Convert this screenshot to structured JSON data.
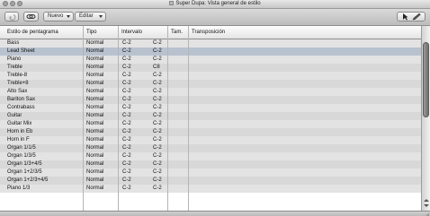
{
  "window": {
    "title": "Super Dupa: Vista general de estilo"
  },
  "toolbar": {
    "undo_icon": "undo-icon",
    "link_icon": "link-icon",
    "new_label": "Nuevo",
    "edit_label": "Editar",
    "pointer_tool_icon": "pointer-tool-icon",
    "pencil_tool_icon": "pencil-tool-icon"
  },
  "table": {
    "columns": [
      "Estilo de pentagrama",
      "Tipo",
      "Intervalo",
      "Tam.",
      "Transposición"
    ],
    "rows": [
      {
        "style": "Bass",
        "type": "Normal",
        "low": "C-2",
        "high": "C-2"
      },
      {
        "style": "Lead Sheet",
        "type": "Normal",
        "low": "C-2",
        "high": "C-2",
        "selected": true
      },
      {
        "style": "Piano",
        "type": "Normal",
        "low": "C-2",
        "high": "C-2"
      },
      {
        "style": "Treble",
        "type": "Normal",
        "low": "C-2",
        "high": "C8"
      },
      {
        "style": "Treble-8",
        "type": "Normal",
        "low": "C-2",
        "high": "C-2"
      },
      {
        "style": "Treble+8",
        "type": "Normal",
        "low": "C-2",
        "high": "C-2"
      },
      {
        "style": "Alto Sax",
        "type": "Normal",
        "low": "C-2",
        "high": "C-2"
      },
      {
        "style": "Bariton Sax",
        "type": "Normal",
        "low": "C-2",
        "high": "C-2"
      },
      {
        "style": "Contrabass",
        "type": "Normal",
        "low": "C-2",
        "high": "C-2"
      },
      {
        "style": "Guitar",
        "type": "Normal",
        "low": "C-2",
        "high": "C-2"
      },
      {
        "style": "Guitar Mix",
        "type": "Normal",
        "low": "C-2",
        "high": "C-2"
      },
      {
        "style": "Horn in Eb",
        "type": "Normal",
        "low": "C-2",
        "high": "C-2"
      },
      {
        "style": "Horn in F",
        "type": "Normal",
        "low": "C-2",
        "high": "C-2"
      },
      {
        "style": "Organ 1/1/5",
        "type": "Normal",
        "low": "C-2",
        "high": "C-2"
      },
      {
        "style": "Organ 1/3/5",
        "type": "Normal",
        "low": "C-2",
        "high": "C-2"
      },
      {
        "style": "Organ 1/3+4/5",
        "type": "Normal",
        "low": "C-2",
        "high": "C-2"
      },
      {
        "style": "Organ 1+2/3/5",
        "type": "Normal",
        "low": "C-2",
        "high": "C-2"
      },
      {
        "style": "Organ 1+2/3+4/5",
        "type": "Normal",
        "low": "C-2",
        "high": "C-2"
      },
      {
        "style": "Piano 1/3",
        "type": "Normal",
        "low": "C-2",
        "high": "C-2"
      }
    ]
  },
  "colors": {
    "selection": "#b8c2cf",
    "row_odd": "#e3e3e3",
    "row_even": "#d8d8d8"
  }
}
